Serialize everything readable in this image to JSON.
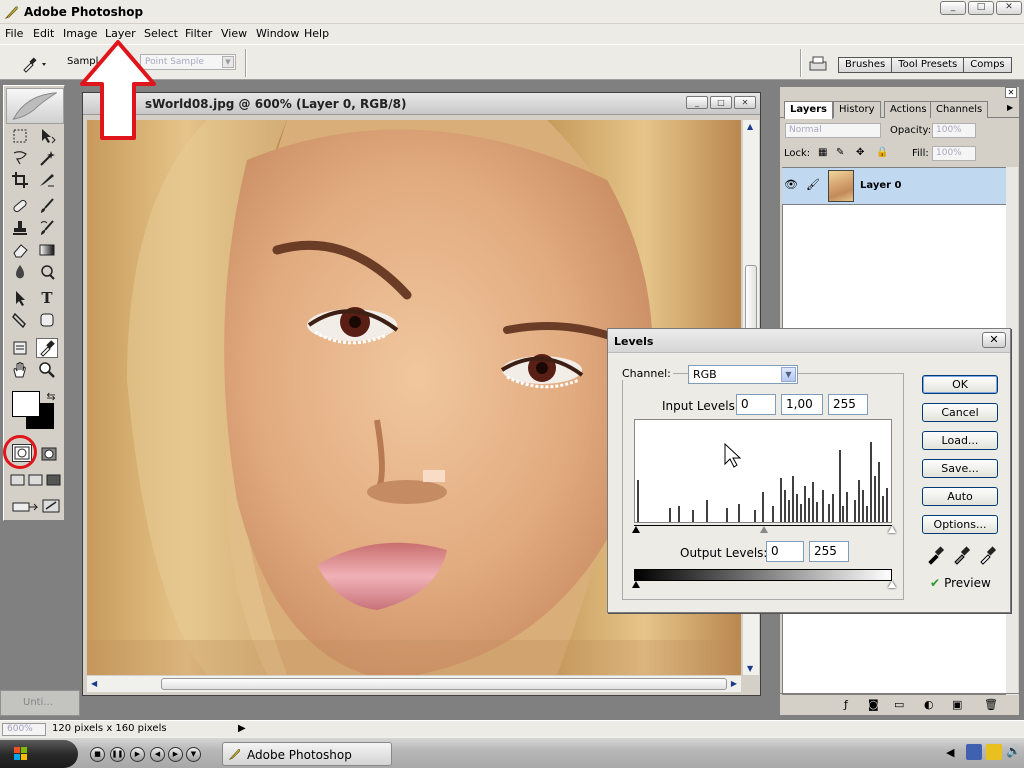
{
  "window": {
    "title": "Adobe Photoshop",
    "minimize_label": "_",
    "restore_label": "□",
    "close_label": "✕"
  },
  "menu": [
    "File",
    "Edit",
    "Image",
    "Layer",
    "Select",
    "Filter",
    "View",
    "Window",
    "Help"
  ],
  "options_bar": {
    "sample_label": "Sampl",
    "sample_value": "Point Sample",
    "palette_well": [
      "Brushes",
      "Tool Presets",
      "Comps"
    ]
  },
  "document": {
    "title": "sWorld08.jpg @ 600% (Layer 0, RGB/8)",
    "buttons": [
      "_",
      "□",
      "✕"
    ]
  },
  "minidoc": {
    "title": "Unti..."
  },
  "status": {
    "zoom": "600%",
    "info": "120 pixels x 160 pixels"
  },
  "layers_panel": {
    "tabs": [
      "Layers",
      "History",
      "Actions",
      "Channels"
    ],
    "active_tab": "Layers",
    "blend_mode": "Normal",
    "opacity_label": "Opacity:",
    "opacity_value": "100%",
    "lock_label": "Lock:",
    "fill_label": "Fill:",
    "fill_value": "100%",
    "layers": [
      {
        "name": "Layer 0",
        "visible": true
      }
    ]
  },
  "levels": {
    "title": "Levels",
    "close_label": "✕",
    "channel_label": "Channel:",
    "channel_value": "RGB",
    "input_label": "Input Levels:",
    "input_values": [
      "0",
      "1,00",
      "255"
    ],
    "output_label": "Output Levels:",
    "output_values": [
      "0",
      "255"
    ],
    "buttons": [
      "OK",
      "Cancel",
      "Load...",
      "Save...",
      "Auto",
      "Options..."
    ],
    "preview_label": "Preview",
    "preview_checked": true
  },
  "taskbar": {
    "items": [
      "Adobe Photoshop"
    ]
  },
  "colors": {
    "annotation_red": "#e0141b",
    "selected_layer": "#c0d8f0",
    "chrome": "#ecebe6"
  }
}
